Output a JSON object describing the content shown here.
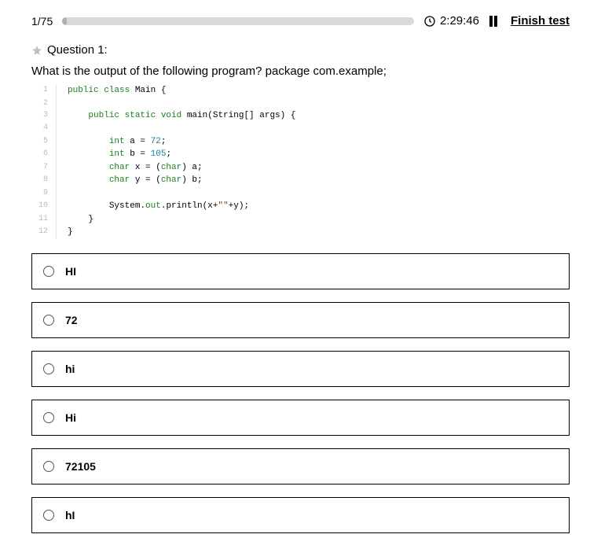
{
  "topbar": {
    "progress_label": "1/75",
    "progress_percent": 1.33,
    "timer": "2:29:46",
    "finish_label": "Finish test"
  },
  "question": {
    "header": "Question 1:",
    "prompt": "What is the output of the following program? package com.example;",
    "code_lines": [
      {
        "n": "1",
        "indent": 0,
        "tokens": [
          {
            "t": "public class",
            "c": "kw-pub"
          },
          {
            "t": " Main {",
            "c": ""
          }
        ]
      },
      {
        "n": "2",
        "indent": 0,
        "tokens": []
      },
      {
        "n": "3",
        "indent": 1,
        "tokens": [
          {
            "t": "public static void",
            "c": "kw-pub"
          },
          {
            "t": " main(String[] args) {",
            "c": ""
          }
        ]
      },
      {
        "n": "4",
        "indent": 1,
        "tokens": []
      },
      {
        "n": "5",
        "indent": 2,
        "tokens": [
          {
            "t": "int",
            "c": "kw-type"
          },
          {
            "t": " a = ",
            "c": ""
          },
          {
            "t": "72",
            "c": "num"
          },
          {
            "t": ";",
            "c": ""
          }
        ]
      },
      {
        "n": "6",
        "indent": 2,
        "tokens": [
          {
            "t": "int",
            "c": "kw-type"
          },
          {
            "t": " b = ",
            "c": ""
          },
          {
            "t": "105",
            "c": "num"
          },
          {
            "t": ";",
            "c": ""
          }
        ]
      },
      {
        "n": "7",
        "indent": 2,
        "tokens": [
          {
            "t": "char",
            "c": "kw-type"
          },
          {
            "t": " x = (",
            "c": ""
          },
          {
            "t": "char",
            "c": "kw-type"
          },
          {
            "t": ") a;",
            "c": ""
          }
        ]
      },
      {
        "n": "8",
        "indent": 2,
        "tokens": [
          {
            "t": "char",
            "c": "kw-type"
          },
          {
            "t": " y = (",
            "c": ""
          },
          {
            "t": "char",
            "c": "kw-type"
          },
          {
            "t": ") b;",
            "c": ""
          }
        ]
      },
      {
        "n": "9",
        "indent": 2,
        "tokens": []
      },
      {
        "n": "10",
        "indent": 2,
        "tokens": [
          {
            "t": "System.",
            "c": ""
          },
          {
            "t": "out",
            "c": "fn"
          },
          {
            "t": ".println(x+",
            "c": ""
          },
          {
            "t": "\"\"",
            "c": "str"
          },
          {
            "t": "+y);",
            "c": ""
          }
        ]
      },
      {
        "n": "11",
        "indent": 1,
        "tokens": [
          {
            "t": "}",
            "c": ""
          }
        ]
      },
      {
        "n": "12",
        "indent": 0,
        "tokens": [
          {
            "t": "}",
            "c": ""
          }
        ]
      }
    ]
  },
  "options": [
    {
      "label": "HI"
    },
    {
      "label": "72"
    },
    {
      "label": "hi"
    },
    {
      "label": "Hi"
    },
    {
      "label": "72105"
    },
    {
      "label": "hI"
    }
  ]
}
